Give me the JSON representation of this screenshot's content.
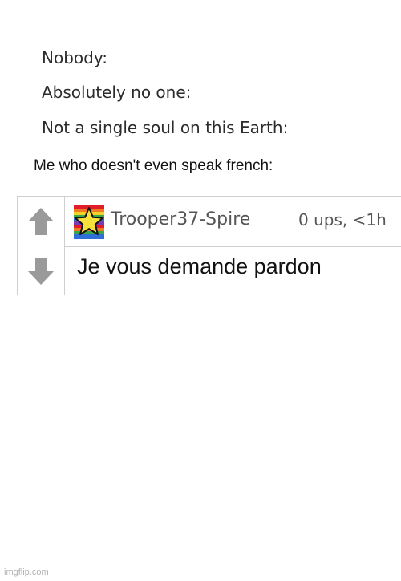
{
  "meme": {
    "line1": "Nobody:",
    "line2": "Absolutely no one:",
    "line3": "Not a single soul on this Earth:",
    "caption": "Me who doesn't even speak french:"
  },
  "comment": {
    "username": "Trooper37-Spire",
    "meta": "0 ups, <1h",
    "body": "Je vous demande pardon",
    "upvote_icon": "arrow-up-icon",
    "downvote_icon": "arrow-down-icon",
    "avatar_icon": "rainbow-star-flag-icon"
  },
  "watermark": "imgflip.com",
  "colors": {
    "arrow": "#9a9a9a",
    "border": "#cfcfcf",
    "star": "#f7e13a"
  }
}
